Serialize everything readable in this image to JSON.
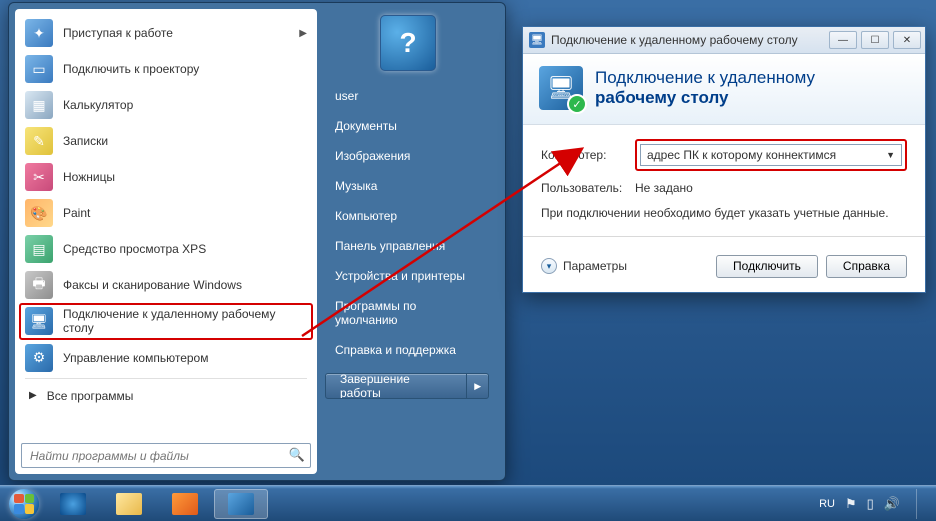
{
  "colors": {
    "highlight": "#d40000",
    "link": "#003e8a"
  },
  "start_menu": {
    "programs": [
      {
        "label": "Приступая к работе",
        "has_submenu": true,
        "icon": "ico-start"
      },
      {
        "label": "Подключить к проектору",
        "has_submenu": false,
        "icon": "ico-proj"
      },
      {
        "label": "Калькулятор",
        "has_submenu": false,
        "icon": "ico-calc"
      },
      {
        "label": "Записки",
        "has_submenu": false,
        "icon": "ico-notes"
      },
      {
        "label": "Ножницы",
        "has_submenu": false,
        "icon": "ico-scis"
      },
      {
        "label": "Paint",
        "has_submenu": false,
        "icon": "ico-paint"
      },
      {
        "label": "Средство просмотра XPS",
        "has_submenu": false,
        "icon": "ico-xps"
      },
      {
        "label": "Факсы и сканирование Windows",
        "has_submenu": false,
        "icon": "ico-fax"
      },
      {
        "label": "Подключение к удаленному рабочему столу",
        "has_submenu": false,
        "icon": "ico-rdp",
        "highlighted": true
      },
      {
        "label": "Управление компьютером",
        "has_submenu": false,
        "icon": "ico-mgmt"
      }
    ],
    "all_programs_label": "Все программы",
    "search_placeholder": "Найти программы и файлы",
    "right_links": [
      "user",
      "Документы",
      "Изображения",
      "Музыка",
      "Компьютер",
      "Панель управления",
      "Устройства и принтеры",
      "Программы по умолчанию",
      "Справка и поддержка"
    ],
    "shutdown_label": "Завершение работы"
  },
  "rdc": {
    "title": "Подключение к удаленному рабочему столу",
    "header_line1": "Подключение к удаленному",
    "header_line2": "рабочему столу",
    "computer_label": "Компьютер:",
    "computer_value": "адрес ПК к которому коннектимся",
    "user_label": "Пользователь:",
    "user_value": "Не задано",
    "note": "При подключении необходимо будет указать учетные данные.",
    "options_label": "Параметры",
    "connect_button": "Подключить",
    "help_button": "Справка"
  },
  "taskbar": {
    "pinned": [
      "ie",
      "explorer",
      "wmp",
      "rdp"
    ],
    "active_index": 3,
    "lang": "RU"
  }
}
